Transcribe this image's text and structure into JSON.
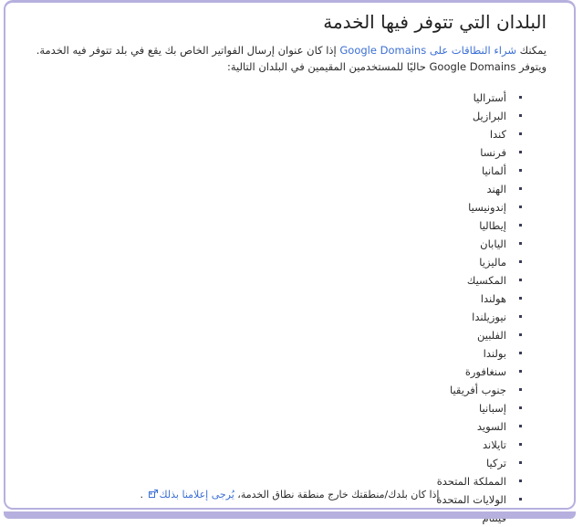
{
  "page": {
    "title": "البلدان التي تتوفر فيها الخدمة",
    "direction": "rtl",
    "language": "ar",
    "border_color": "#b6b0de",
    "link_color": "#3b6fd4",
    "text_color": "#2b2b2b"
  },
  "intro": {
    "before_link": "يمكنك ",
    "link_text": "شراء النطاقات على Google Domains",
    "after_link": " إذا كان عنوان إرسال الفواتير الخاص بك يقع في بلد تتوفر فيه الخدمة. ويتوفر Google Domains حاليًا للمستخدمين المقيمين في البلدان التالية:"
  },
  "countries": [
    "أستراليا",
    "البرازيل",
    "كندا",
    "فرنسا",
    "ألمانيا",
    "الهند",
    "إندونيسيا",
    "إيطاليا",
    "اليابان",
    "ماليزيا",
    "المكسيك",
    "هولندا",
    "نيوزيلندا",
    "الفلبين",
    "بولندا",
    "سنغافورة",
    "جنوب أفريقيا",
    "إسبانيا",
    "السويد",
    "تايلاند",
    "تركيا",
    "المملكة المتحدة",
    "الولايات المتحدة",
    "فيتنام"
  ],
  "footnote": {
    "before_link": "إذا كان بلدك/منطقتك خارج منطقة نطاق الخدمة، ",
    "link_text": "يُرجى إعلامنا بذلك",
    "icon": "external-link-icon",
    "after_link": " ."
  }
}
